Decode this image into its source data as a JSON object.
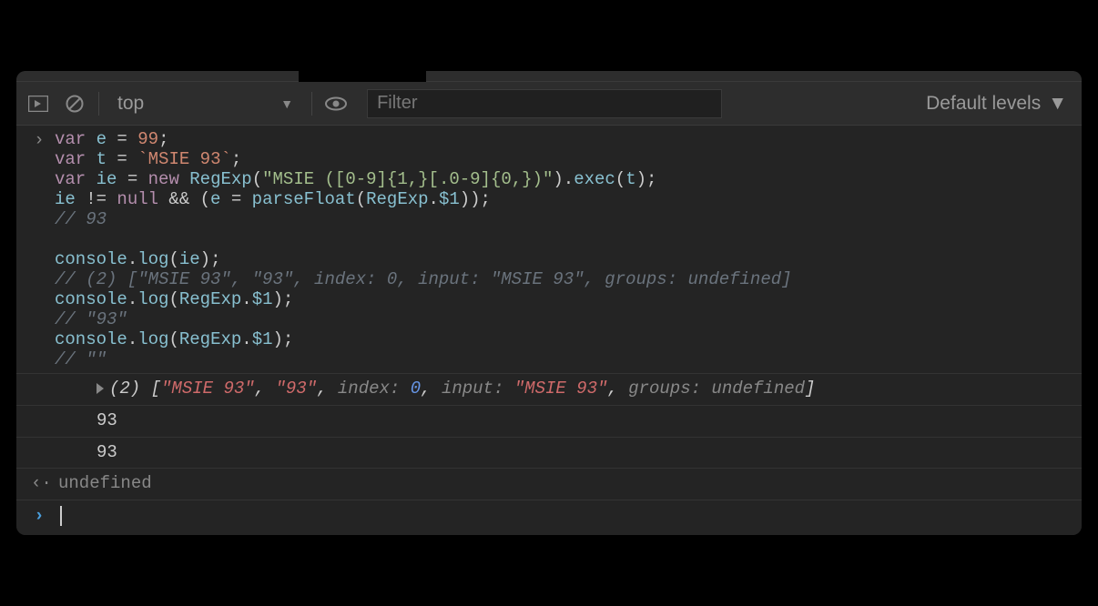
{
  "toolbar": {
    "context": "top",
    "filter_placeholder": "Filter",
    "levels": "Default levels"
  },
  "code": {
    "lines": [
      {
        "t": "code",
        "tokens": [
          [
            "kw",
            "var"
          ],
          [
            "op",
            " "
          ],
          [
            "id",
            "e"
          ],
          [
            "op",
            " = "
          ],
          [
            "num",
            "99"
          ],
          [
            "punct",
            ";"
          ]
        ]
      },
      {
        "t": "code",
        "tokens": [
          [
            "kw",
            "var"
          ],
          [
            "op",
            " "
          ],
          [
            "id",
            "t"
          ],
          [
            "op",
            " = "
          ],
          [
            "tpl",
            "`MSIE 93`"
          ],
          [
            "punct",
            ";"
          ]
        ]
      },
      {
        "t": "code",
        "tokens": [
          [
            "kw",
            "var"
          ],
          [
            "op",
            " "
          ],
          [
            "id",
            "ie"
          ],
          [
            "op",
            " = "
          ],
          [
            "kw",
            "new"
          ],
          [
            "op",
            " "
          ],
          [
            "fn",
            "RegExp"
          ],
          [
            "punct",
            "("
          ],
          [
            "str",
            "\"MSIE ([0-9]{1,}[.0-9]{0,})\""
          ],
          [
            "punct",
            ")."
          ],
          [
            "fn",
            "exec"
          ],
          [
            "punct",
            "("
          ],
          [
            "id",
            "t"
          ],
          [
            "punct",
            ");"
          ]
        ]
      },
      {
        "t": "code",
        "tokens": [
          [
            "id",
            "ie"
          ],
          [
            "op",
            " != "
          ],
          [
            "kw",
            "null"
          ],
          [
            "op",
            " && ("
          ],
          [
            "id",
            "e"
          ],
          [
            "op",
            " = "
          ],
          [
            "fn",
            "parseFloat"
          ],
          [
            "punct",
            "("
          ],
          [
            "id",
            "RegExp"
          ],
          [
            "punct",
            "."
          ],
          [
            "prop",
            "$1"
          ],
          [
            "punct",
            "));"
          ]
        ]
      },
      {
        "t": "comment",
        "text": "// 93"
      },
      {
        "t": "blank"
      },
      {
        "t": "code",
        "tokens": [
          [
            "id",
            "console"
          ],
          [
            "punct",
            "."
          ],
          [
            "fn",
            "log"
          ],
          [
            "punct",
            "("
          ],
          [
            "id",
            "ie"
          ],
          [
            "punct",
            ");"
          ]
        ]
      },
      {
        "t": "comment",
        "text": "// (2) [\"MSIE 93\", \"93\", index: 0, input: \"MSIE 93\", groups: undefined]"
      },
      {
        "t": "code",
        "tokens": [
          [
            "id",
            "console"
          ],
          [
            "punct",
            "."
          ],
          [
            "fn",
            "log"
          ],
          [
            "punct",
            "("
          ],
          [
            "id",
            "RegExp"
          ],
          [
            "punct",
            "."
          ],
          [
            "prop",
            "$1"
          ],
          [
            "punct",
            ");"
          ]
        ]
      },
      {
        "t": "comment",
        "text": "// \"93\""
      },
      {
        "t": "code",
        "tokens": [
          [
            "id",
            "console"
          ],
          [
            "punct",
            "."
          ],
          [
            "fn",
            "log"
          ],
          [
            "punct",
            "("
          ],
          [
            "id",
            "RegExp"
          ],
          [
            "punct",
            "."
          ],
          [
            "prop",
            "$1"
          ],
          [
            "punct",
            ");"
          ]
        ]
      },
      {
        "t": "comment",
        "text": "// \"\""
      }
    ]
  },
  "outputs": {
    "array_row": {
      "count": "(2)",
      "parts": [
        [
          "out-plain",
          " ["
        ],
        [
          "out-str",
          "\"MSIE 93\""
        ],
        [
          "out-plain",
          ", "
        ],
        [
          "out-str",
          "\"93\""
        ],
        [
          "out-plain",
          ", "
        ],
        [
          "out-kw",
          "index: "
        ],
        [
          "out-num",
          "0"
        ],
        [
          "out-plain",
          ", "
        ],
        [
          "out-kw",
          "input: "
        ],
        [
          "out-str",
          "\"MSIE 93\""
        ],
        [
          "out-plain",
          ", "
        ],
        [
          "out-kw",
          "groups: "
        ],
        [
          "out-kw",
          "undefined"
        ],
        [
          "out-plain",
          "]"
        ]
      ]
    },
    "row2": "93",
    "row3": "93",
    "return_row": "undefined"
  }
}
